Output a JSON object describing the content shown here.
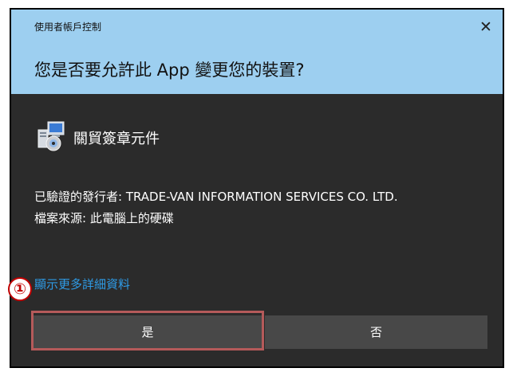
{
  "dialog": {
    "caption": "使用者帳戶控制",
    "question": "您是否要允許此 App 變更您的裝置?",
    "close_glyph": "✕",
    "colors": {
      "header_bg": "#9dcff0",
      "body_bg": "#2b2b2b",
      "button_bg": "#484848",
      "link": "#2e9be6"
    }
  },
  "app": {
    "name": "關貿簽章元件",
    "icon": "installer-setup-icon",
    "publisher_line": "已驗證的發行者: TRADE-VAN INFORMATION SERVICES CO. LTD.",
    "origin_line": "檔案來源: 此電腦上的硬碟"
  },
  "details_link": "顯示更多詳細資料",
  "buttons": {
    "yes": "是",
    "no": "否"
  },
  "annotation": {
    "step_number": "①",
    "highlight_color": "#b55a5a"
  }
}
